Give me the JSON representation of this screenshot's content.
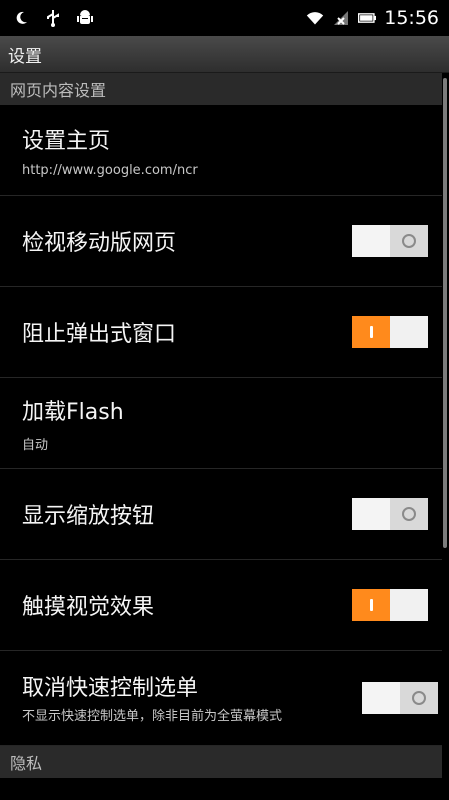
{
  "status_bar": {
    "time": "15:56",
    "icons": [
      "moon-icon",
      "usb-icon",
      "android-debug-icon",
      "wifi-icon",
      "signal-icon",
      "battery-icon"
    ]
  },
  "title": "设置",
  "sections": [
    {
      "header": "网页内容设置",
      "items": [
        {
          "title": "设置主页",
          "subtitle": "http://www.google.com/ncr"
        },
        {
          "title": "检视移动版网页",
          "toggle": false
        },
        {
          "title": "阻止弹出式窗口",
          "toggle": true
        },
        {
          "title": "加载Flash",
          "subtitle": "自动"
        },
        {
          "title": "显示缩放按钮",
          "toggle": false
        },
        {
          "title": "触摸视觉效果",
          "toggle": true
        },
        {
          "title": "取消快速控制选单",
          "subtitle": "不显示快速控制选单，除非目前为全萤幕模式",
          "toggle": false
        }
      ]
    },
    {
      "header": "隐私"
    }
  ],
  "colors": {
    "accent": "#ff8a1c",
    "toggle_off": "#e8e8e8",
    "section_bg": "#2a2a2a"
  }
}
